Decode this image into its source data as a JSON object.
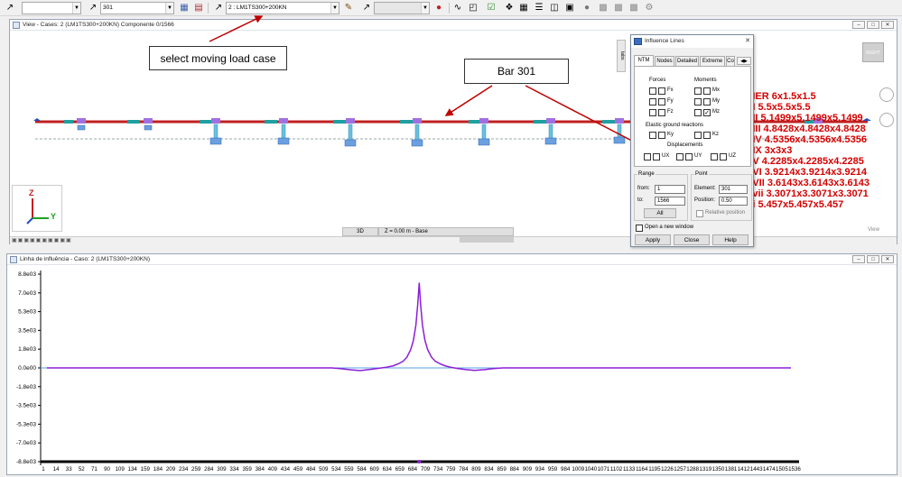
{
  "toolbar": {
    "bar_number": "301",
    "load_case": "2 : LM1TS300+200KN"
  },
  "view_window": {
    "title": "View - Cases: 2 (LM1TS300+200KN) Componente 0/1566",
    "view_mode": "3D",
    "level": "Z = 0.00 m - Base",
    "view_button": "RIGHT",
    "view_label": "View",
    "axis_z": "Z",
    "axis_y": "Y",
    "side_tab": "tabs"
  },
  "annotations": {
    "select_case": "select moving load case",
    "bar": "Bar 301"
  },
  "section_labels": [
    "PIER 6x1.5x1.5",
    "SI 5.5x5.5x5.5",
    "SII 5.1499x5.1499x5.1499",
    "SIII 4.8428x4.8428x4.8428",
    "SIV 4.5356x4.5356x4.5356",
    "SIX 3x3x3",
    "SV 4.2285x4.2285x4.2285",
    "SVI 3.9214x3.9214x3.9214",
    "SVII 3.6143x3.6143x3.6143",
    "Svii 3.3071x3.3071x3.3071",
    "Si 5.457x5.457x5.457"
  ],
  "dialog": {
    "title": "Influence Lines",
    "tabs": [
      "NTM",
      "Nodes",
      "Detailed",
      "Extreme",
      "Co"
    ],
    "forces_label": "Forces",
    "moments_label": "Moments",
    "forces": [
      "Fx",
      "Fy",
      "Fz"
    ],
    "moments": [
      "Mx",
      "My",
      "Mz"
    ],
    "elastic_label": "Elastic ground reactions",
    "elastic": [
      "Ky",
      "Kz"
    ],
    "displacements_label": "Displacements",
    "displacements": [
      "UX",
      "UY",
      "UZ"
    ],
    "range_label": "Range",
    "from_label": "from:",
    "from_value": "1",
    "to_label": "to:",
    "to_value": "1566",
    "all_label": "All",
    "point_label": "Point",
    "element_label": "Element:",
    "element_value": "301",
    "position_label": "Position:",
    "position_value": "0.50",
    "relative_label": "Relative position",
    "open_window_label": "Open a new window",
    "apply": "Apply",
    "close": "Close",
    "help": "Help"
  },
  "influence_window": {
    "title": "Linha de influência - Caso: 2 (LM1TS300+200KN)"
  },
  "chart_data": {
    "type": "line",
    "title": "",
    "xlabel": "",
    "ylabel": "",
    "ylim": [
      -8800,
      8800
    ],
    "y_ticks": [
      "8.8e03",
      "7.0e03",
      "5.3e03",
      "3.5e03",
      "1.8e03",
      "0.0e00",
      "-1.8e03",
      "-3.5e03",
      "-5.3e03",
      "-7.0e03",
      "-8.8e03"
    ],
    "x_ticks": [
      "1",
      "14",
      "33",
      "52",
      "71",
      "90",
      "109",
      "134",
      "159",
      "184",
      "209",
      "234",
      "259",
      "284",
      "309",
      "334",
      "359",
      "384",
      "409",
      "434",
      "459",
      "484",
      "509",
      "534",
      "559",
      "584",
      "609",
      "634",
      "659",
      "684",
      "709",
      "734",
      "759",
      "784",
      "809",
      "834",
      "859",
      "884",
      "909",
      "934",
      "959",
      "984",
      "1009",
      "1040",
      "1071",
      "1102",
      "1133",
      "1164",
      "1195",
      "1226",
      "1257",
      "1288",
      "1319",
      "1350",
      "1381",
      "1412",
      "1443",
      "1474",
      "1505",
      "1536"
    ],
    "xlim": [
      1,
      1566
    ],
    "series": [
      {
        "color": "#8a1ed8",
        "points": [
          [
            1,
            0
          ],
          [
            600,
            0
          ],
          [
            620,
            -80
          ],
          [
            640,
            -180
          ],
          [
            660,
            -250
          ],
          [
            680,
            -150
          ],
          [
            700,
            -30
          ],
          [
            715,
            60
          ],
          [
            730,
            200
          ],
          [
            740,
            380
          ],
          [
            750,
            620
          ],
          [
            758,
            1000
          ],
          [
            766,
            1700
          ],
          [
            772,
            2600
          ],
          [
            777,
            4000
          ],
          [
            781,
            6000
          ],
          [
            784,
            8000
          ],
          [
            787,
            6000
          ],
          [
            791,
            4000
          ],
          [
            796,
            2600
          ],
          [
            802,
            1700
          ],
          [
            810,
            1000
          ],
          [
            818,
            620
          ],
          [
            828,
            380
          ],
          [
            838,
            200
          ],
          [
            850,
            60
          ],
          [
            862,
            -30
          ],
          [
            880,
            -150
          ],
          [
            900,
            -230
          ],
          [
            920,
            -170
          ],
          [
            940,
            -70
          ],
          [
            960,
            0
          ],
          [
            1566,
            0
          ]
        ]
      }
    ]
  }
}
